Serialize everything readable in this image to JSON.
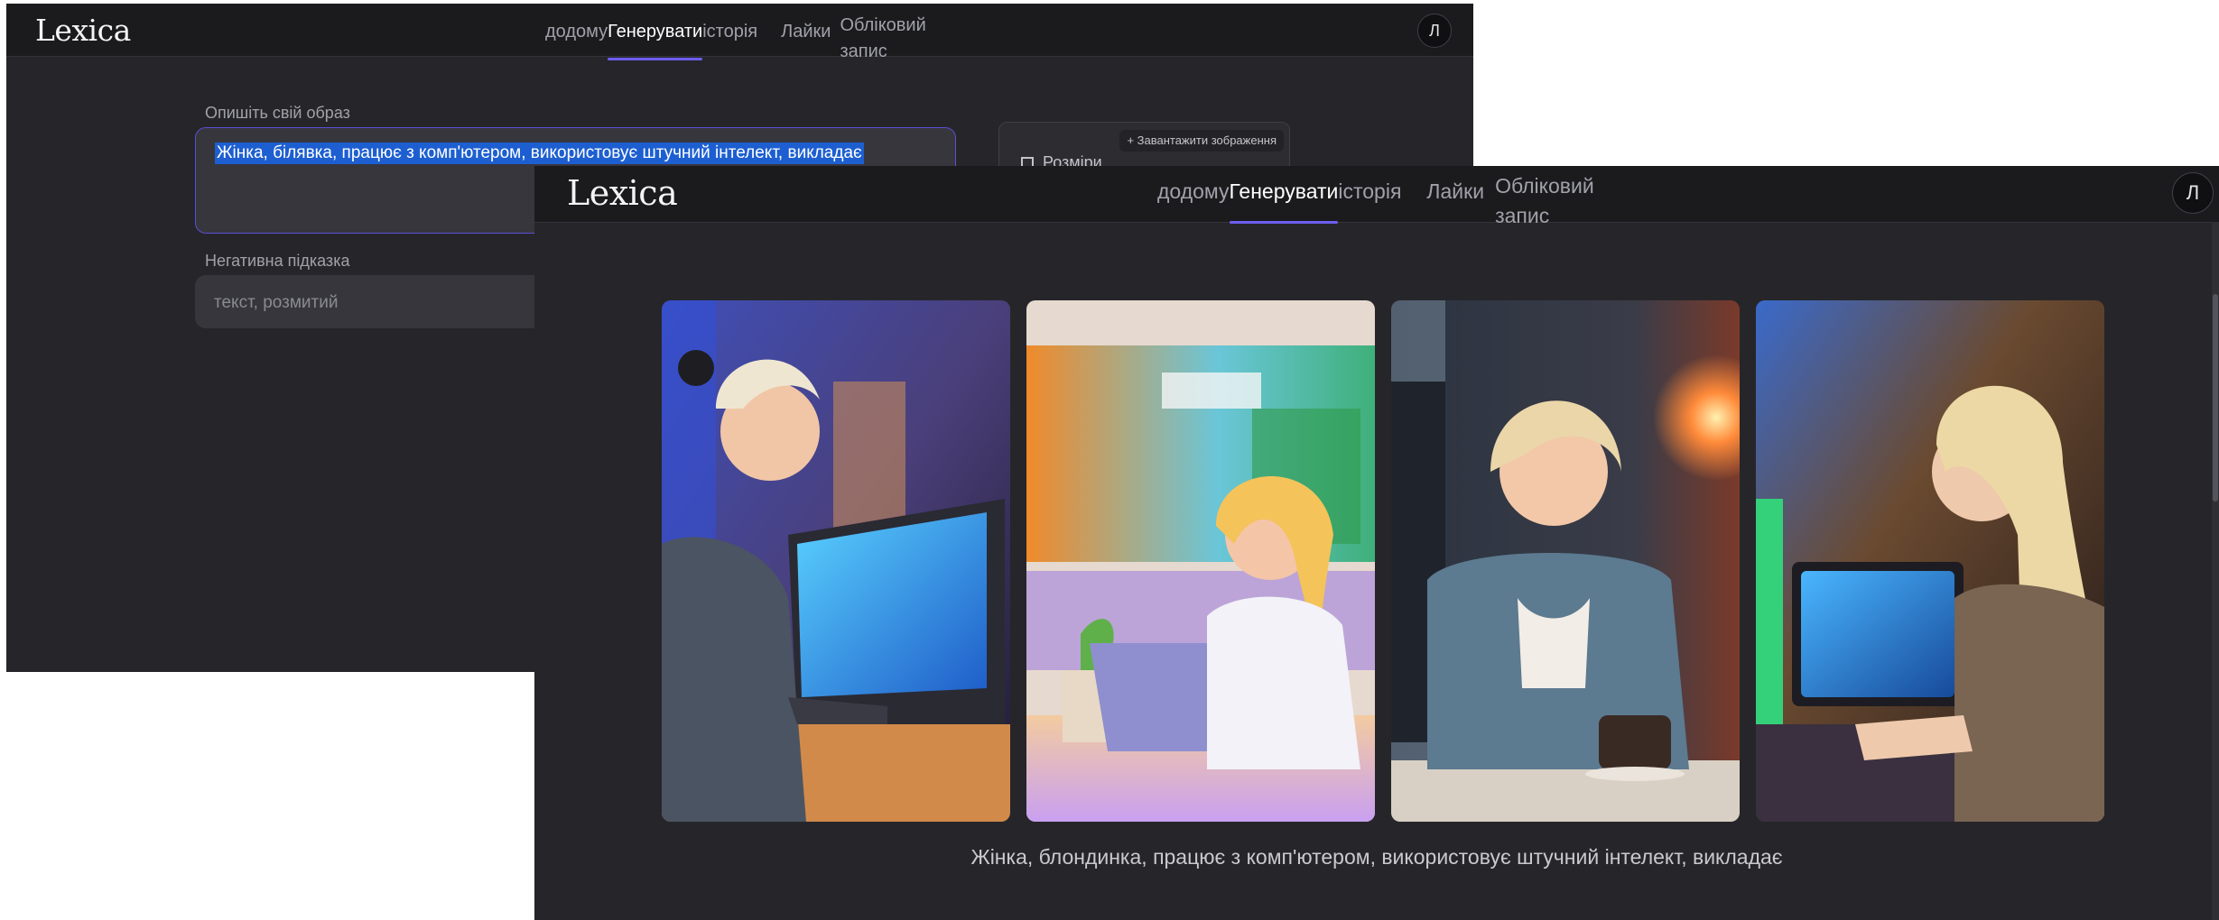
{
  "app": {
    "logo": "Lexica",
    "avatar_letter": "Л"
  },
  "nav": {
    "home": "додому",
    "generate": "Генерувати",
    "history": "історія",
    "likes": "Лайки",
    "account": "Обліковий запис"
  },
  "form": {
    "prompt_label": "Опишіть свій образ",
    "prompt_value": "Жінка, білявка, працює з комп'ютером, використовує штучний інтелект, викладає",
    "negative_label": "Негативна підказка",
    "negative_placeholder": "текст, розмитий",
    "upload_button": "+ Завантажити зображення",
    "sizes_label": "Розміри"
  },
  "results": {
    "caption": "Жінка, блондинка, працює з комп'ютером, використовує штучний інтелект, викладає",
    "images": [
      {
        "subject": "blonde woman at a desktop computer in blue-lit office"
      },
      {
        "subject": "blonde woman with laptop in front of colorful code display"
      },
      {
        "subject": "blonde woman smiling at computer with coffee cup"
      },
      {
        "subject": "blonde woman typing on keyboard with blue screen"
      }
    ]
  },
  "colors": {
    "background": "#26262a",
    "topbar": "#1b1b1e",
    "accent": "#6d5ef0",
    "selection": "#1d5fd1"
  }
}
